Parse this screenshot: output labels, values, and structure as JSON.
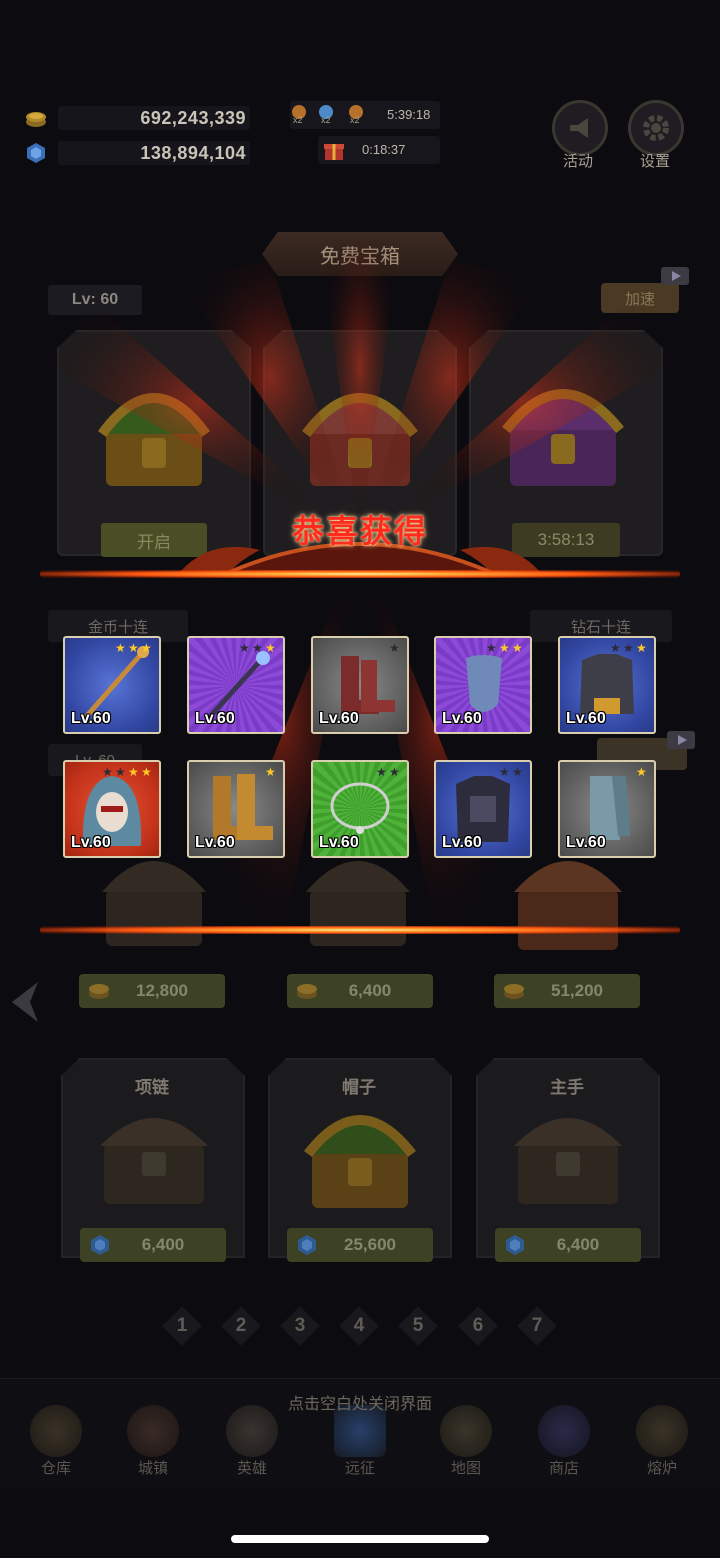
{
  "resources": {
    "gold": "692,243,339",
    "gems": "138,894,104"
  },
  "boosts": {
    "multipliers": [
      "x2",
      "x2",
      "x2"
    ],
    "boost_timer": "5:39:18",
    "gift_timer": "0:18:37"
  },
  "top_buttons": {
    "event_label": "活动",
    "settings_label": "设置"
  },
  "free_chest": {
    "title": "免费宝箱",
    "level": "Lv: 60",
    "speedup_label": "加速",
    "open_label": "开启",
    "countdown": "3:58:13"
  },
  "ten_draw": {
    "gold_label": "金币十连",
    "gem_label": "钻石十连",
    "level_partial": "Lv. 60"
  },
  "chest_prices": [
    "12,800",
    "6,400",
    "51,200"
  ],
  "equipment_sections": [
    {
      "title": "项链",
      "price": "6,400"
    },
    {
      "title": "帽子",
      "price": "25,600"
    },
    {
      "title": "主手",
      "price": "6,400"
    }
  ],
  "pagination": [
    "1",
    "2",
    "3",
    "4",
    "5",
    "6",
    "7"
  ],
  "reward_popup": {
    "title": "恭喜获得",
    "items": [
      {
        "name": "staff-item",
        "level": "Lv.60",
        "quality": "blue",
        "stars_on": 3,
        "stars_total": 3
      },
      {
        "name": "scepter-item",
        "level": "Lv.60",
        "quality": "purple",
        "stars_on": 1,
        "stars_total": 3
      },
      {
        "name": "boots-item",
        "level": "Lv.60",
        "quality": "gray",
        "stars_on": 0,
        "stars_total": 1
      },
      {
        "name": "shield-item",
        "level": "Lv.60",
        "quality": "purple",
        "stars_on": 2,
        "stars_total": 3
      },
      {
        "name": "armor-item",
        "level": "Lv.60",
        "quality": "blue",
        "stars_on": 1,
        "stars_total": 3
      },
      {
        "name": "hood-mask-item",
        "level": "Lv.60",
        "quality": "red",
        "stars_on": 2,
        "stars_total": 4
      },
      {
        "name": "leather-boots-item",
        "level": "Lv.60",
        "quality": "gray",
        "stars_on": 1,
        "stars_total": 1
      },
      {
        "name": "necklace-item",
        "level": "Lv.60",
        "quality": "green",
        "stars_on": 0,
        "stars_total": 2
      },
      {
        "name": "plate-armor-item",
        "level": "Lv.60",
        "quality": "blue",
        "stars_on": 0,
        "stars_total": 2
      },
      {
        "name": "greaves-item",
        "level": "Lv.60",
        "quality": "gray",
        "stars_on": 1,
        "stars_total": 1
      }
    ],
    "close_hint": "点击空白处关闭界面"
  },
  "tabbar": [
    "仓库",
    "城镇",
    "英雄",
    "远征",
    "地图",
    "商店",
    "熔炉"
  ],
  "colors": {
    "title_red": "#ff2b1f",
    "star_gold": "#ffc928",
    "glow_orange": "#ff5a12"
  }
}
